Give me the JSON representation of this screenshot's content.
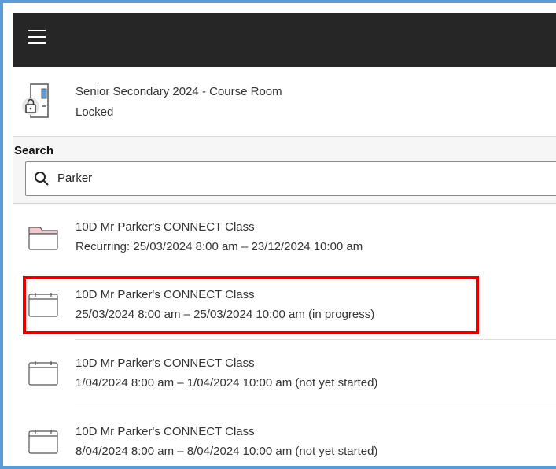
{
  "topbar": {
    "menu_icon": "hamburger-menu-icon"
  },
  "course_room": {
    "icon": "locked-door-icon",
    "title": "Senior Secondary 2024 - Course Room",
    "status": "Locked"
  },
  "search": {
    "label": "Search",
    "value": "Parker",
    "icon": "search-icon"
  },
  "sessions": [
    {
      "icon": "folder-icon",
      "title": "10D Mr Parker's CONNECT Class",
      "time": "Recurring: 25/03/2024 8:00 am – 23/12/2024 10:00 am"
    },
    {
      "icon": "calendar-icon",
      "title": "10D Mr Parker's CONNECT Class",
      "time": "25/03/2024 8:00 am – 25/03/2024 10:00 am (in progress)",
      "highlighted": true
    },
    {
      "icon": "calendar-icon",
      "title": "10D Mr Parker's CONNECT Class",
      "time": "1/04/2024 8:00 am – 1/04/2024 10:00 am (not yet started)"
    },
    {
      "icon": "calendar-icon",
      "title": "10D Mr Parker's CONNECT Class",
      "time": "8/04/2024 8:00 am – 8/04/2024 10:00 am (not yet started)"
    }
  ],
  "colors": {
    "topbar": "#262626",
    "frame_border": "#5b9bd5",
    "highlight_border": "#e00000",
    "folder_tab": "#f4c7cc"
  }
}
